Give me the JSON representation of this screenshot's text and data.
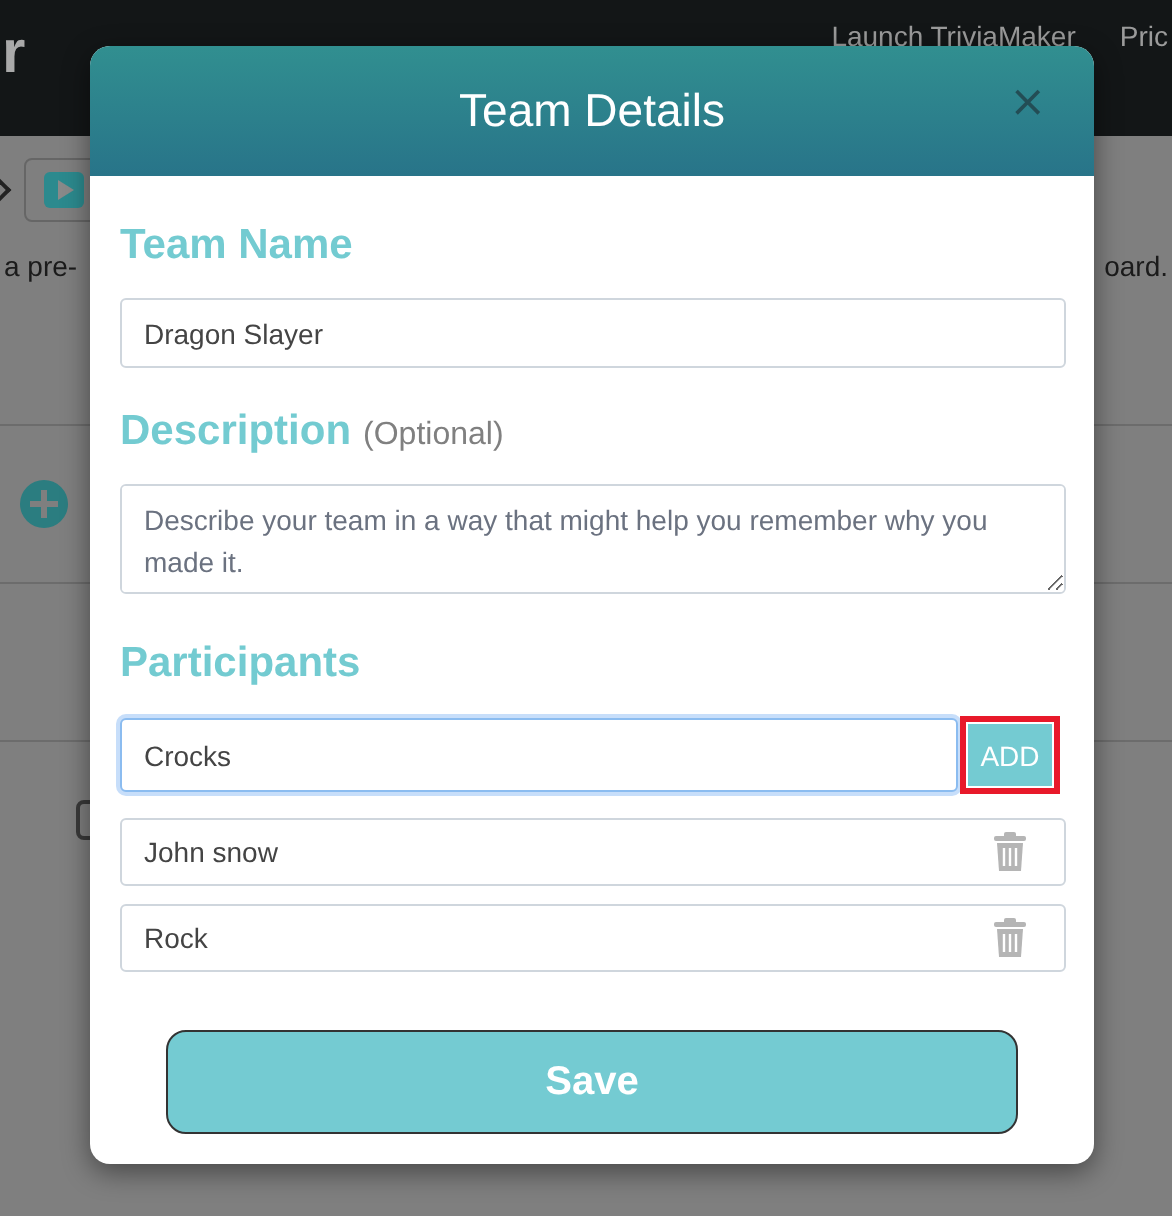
{
  "background": {
    "logo_fragment": "r",
    "nav_links": [
      "Launch TriviaMaker",
      "Pric"
    ],
    "text_left": "a pre-",
    "text_right": "oard."
  },
  "dialog": {
    "title": "Team Details",
    "close": "×",
    "team_name": {
      "label": "Team Name",
      "value": "Dragon Slayer"
    },
    "description": {
      "label": "Description",
      "note": "(Optional)",
      "placeholder": "Describe your team in a way that might help you remember why you made it."
    },
    "participants": {
      "label": "Participants",
      "input_value": "Crocks",
      "add_button": "ADD",
      "add_highlighted": true,
      "items": [
        {
          "name": "John snow"
        },
        {
          "name": "Rock"
        }
      ]
    },
    "save_button": "Save"
  }
}
